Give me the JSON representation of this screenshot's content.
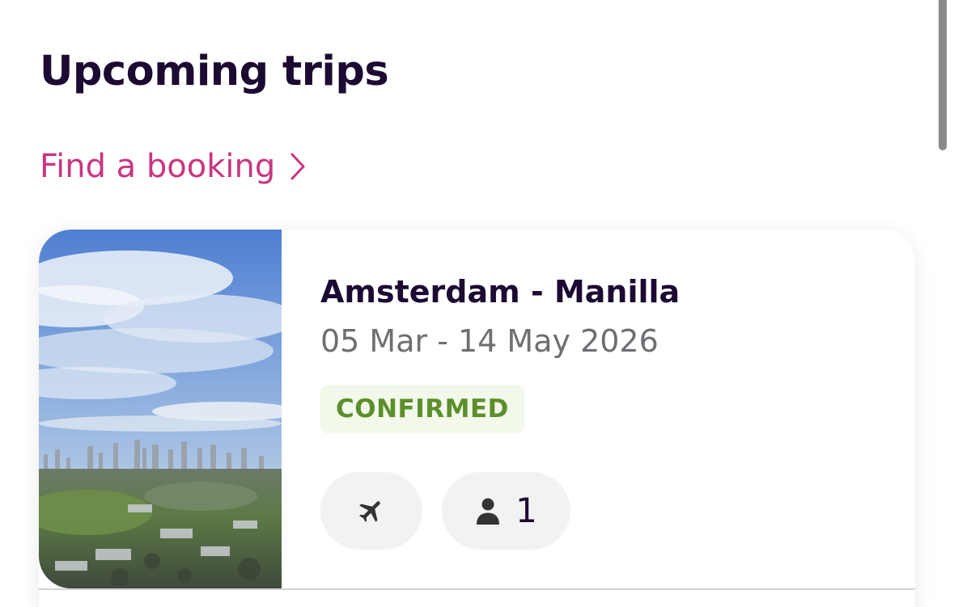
{
  "header": {
    "title": "Upcoming trips"
  },
  "find_booking": {
    "label": "Find a booking",
    "icon": "chevron-right-icon"
  },
  "trip": {
    "route": "Amsterdam - Manilla",
    "dates": "05 Mar - 14 May 2026",
    "status": "CONFIRMED",
    "flight_icon": "airplane-icon",
    "passenger_icon": "person-icon",
    "passengers": "1"
  },
  "colors": {
    "title": "#1c0a33",
    "link": "#c93680",
    "dates": "#6e6e73",
    "status_text": "#5c8f2b",
    "status_bg": "#f2f8ea",
    "chip_bg": "#f2f2f2"
  }
}
